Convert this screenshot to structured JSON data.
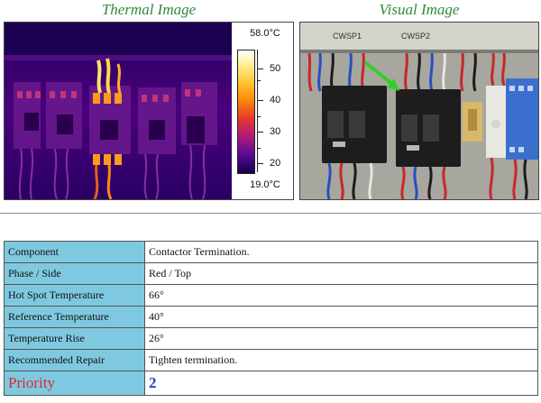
{
  "titles": {
    "thermal": "Thermal Image",
    "visual": "Visual Image"
  },
  "thermal": {
    "scale_max": "58.0°C",
    "scale_min": "19.0°C",
    "ticks": [
      "50",
      "40",
      "30",
      "20"
    ],
    "colors": {
      "background": "#3a0075",
      "hot": "#ffcf3a",
      "warm": "#e2611a"
    }
  },
  "visual": {
    "labels": [
      "CWSP1",
      "CWSP2"
    ],
    "arrow_color": "#31d023"
  },
  "details": {
    "rows": [
      {
        "label": "Component",
        "value": "Contactor Termination."
      },
      {
        "label": "Phase / Side",
        "value": "Red / Top"
      },
      {
        "label": "Hot Spot Temperature",
        "value": "66°"
      },
      {
        "label": "Reference Temperature",
        "value": "40°"
      },
      {
        "label": "Temperature Rise",
        "value": "26°"
      },
      {
        "label": "Recommended Repair",
        "value": "Tighten termination."
      }
    ],
    "priority": {
      "label": "Priority",
      "value": "2"
    }
  },
  "colors": {
    "title_green": "#2e8b3a",
    "label_cell_bg": "#7fc9e0",
    "priority_label": "#e0262b",
    "priority_value": "#2a3fc0"
  }
}
